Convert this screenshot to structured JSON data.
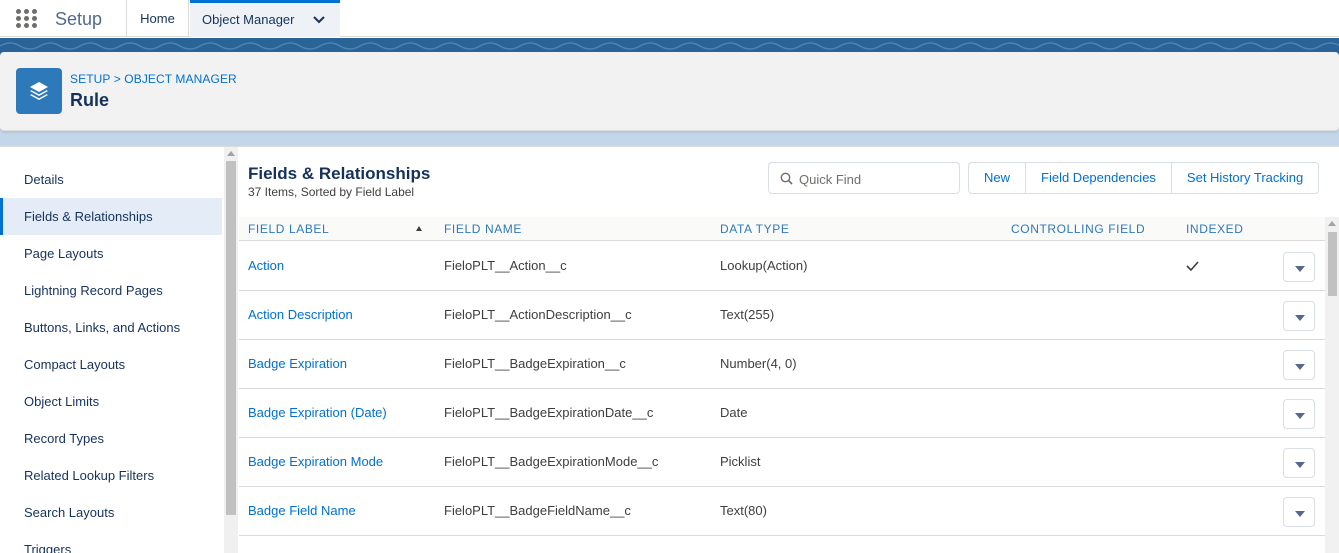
{
  "topbar": {
    "app_name": "Setup",
    "tabs": [
      {
        "label": "Home"
      },
      {
        "label": "Object Manager"
      }
    ]
  },
  "header": {
    "breadcrumb": [
      "SETUP",
      "OBJECT MANAGER"
    ],
    "breadcrumb_separator": ">",
    "title": "Rule",
    "icon": "stacked-layers-icon",
    "icon_color": "#2e79b9"
  },
  "sidebar": {
    "active_index": 1,
    "items": [
      {
        "label": "Details"
      },
      {
        "label": "Fields & Relationships"
      },
      {
        "label": "Page Layouts"
      },
      {
        "label": "Lightning Record Pages"
      },
      {
        "label": "Buttons, Links, and Actions"
      },
      {
        "label": "Compact Layouts"
      },
      {
        "label": "Object Limits"
      },
      {
        "label": "Record Types"
      },
      {
        "label": "Related Lookup Filters"
      },
      {
        "label": "Search Layouts"
      },
      {
        "label": "Triggers"
      }
    ]
  },
  "main": {
    "title": "Fields & Relationships",
    "subtitle": "37 Items, Sorted by Field Label",
    "search": {
      "placeholder": "Quick Find",
      "value": ""
    },
    "buttons": [
      "New",
      "Field Dependencies",
      "Set History Tracking"
    ],
    "columns": [
      "FIELD LABEL",
      "FIELD NAME",
      "DATA TYPE",
      "CONTROLLING FIELD",
      "INDEXED"
    ],
    "sorted_column": "FIELD LABEL",
    "sort_direction": "ascending",
    "rows": [
      {
        "label": "Action",
        "name": "FieloPLT__Action__c",
        "type": "Lookup(Action)",
        "controlling": "",
        "indexed": true
      },
      {
        "label": "Action Description",
        "name": "FieloPLT__ActionDescription__c",
        "type": "Text(255)",
        "controlling": "",
        "indexed": false
      },
      {
        "label": "Badge Expiration",
        "name": "FieloPLT__BadgeExpiration__c",
        "type": "Number(4, 0)",
        "controlling": "",
        "indexed": false
      },
      {
        "label": "Badge Expiration (Date)",
        "name": "FieloPLT__BadgeExpirationDate__c",
        "type": "Date",
        "controlling": "",
        "indexed": false
      },
      {
        "label": "Badge Expiration Mode",
        "name": "FieloPLT__BadgeExpirationMode__c",
        "type": "Picklist",
        "controlling": "",
        "indexed": false
      },
      {
        "label": "Badge Field Name",
        "name": "FieloPLT__BadgeFieldName__c",
        "type": "Text(80)",
        "controlling": "",
        "indexed": false
      }
    ]
  },
  "colors": {
    "link": "#0070d2",
    "header_band": "#2a6496",
    "text": "#3e3e3c"
  }
}
